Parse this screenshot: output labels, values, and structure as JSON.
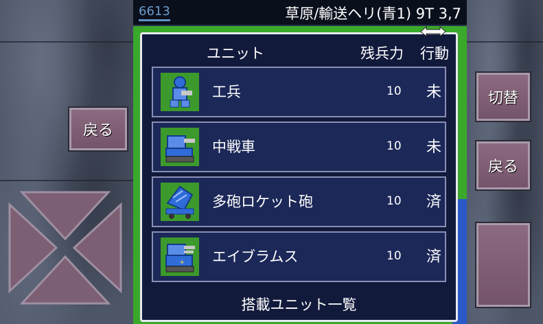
{
  "topbar": {
    "score": "6613",
    "status": "草原/輸送ヘリ(青1) 9T 3,7"
  },
  "dialog": {
    "headers": {
      "unit": "ユニット",
      "hp": "残兵力",
      "action": "行動"
    },
    "units": [
      {
        "name": "工兵",
        "hp": "10",
        "action": "未",
        "icon": "engineer-icon"
      },
      {
        "name": "中戦車",
        "hp": "10",
        "action": "未",
        "icon": "medium-tank-icon"
      },
      {
        "name": "多砲ロケット砲",
        "hp": "10",
        "action": "済",
        "icon": "rocket-launcher-icon"
      },
      {
        "name": "エイブラムス",
        "hp": "10",
        "action": "済",
        "icon": "abrams-tank-icon"
      }
    ],
    "footer": "搭載ユニット一覧"
  },
  "controls": {
    "back_left": "戻る",
    "switch": "切替",
    "back_right": "戻る",
    "action_empty": ""
  },
  "colors": {
    "dialog_bg": "#121a3c",
    "row_bg": "#1c2858",
    "button": "#7e5e74",
    "grass": "#3aa82a",
    "unit_blue": "#2f6cd8"
  }
}
